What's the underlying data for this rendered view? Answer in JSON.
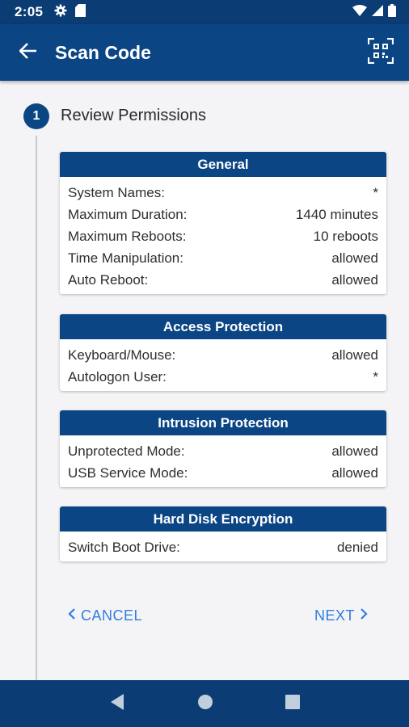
{
  "status_bar": {
    "time": "2:05",
    "icons": [
      "gear-icon",
      "sd-card-icon",
      "wifi-icon",
      "signal-icon",
      "battery-icon"
    ]
  },
  "app_bar": {
    "title": "Scan Code",
    "back_icon": "arrow-left-icon",
    "action_icon": "qr-scan-icon"
  },
  "step": {
    "number": "1",
    "title": "Review Permissions"
  },
  "cards": {
    "general": {
      "header": "General",
      "rows": [
        {
          "label": "System Names:",
          "value": "*"
        },
        {
          "label": "Maximum Duration:",
          "value": "1440 minutes"
        },
        {
          "label": "Maximum Reboots:",
          "value": "10 reboots"
        },
        {
          "label": "Time Manipulation:",
          "value": "allowed"
        },
        {
          "label": "Auto Reboot:",
          "value": "allowed"
        }
      ]
    },
    "access": {
      "header": "Access Protection",
      "rows": [
        {
          "label": "Keyboard/Mouse:",
          "value": "allowed"
        },
        {
          "label": "Autologon User:",
          "value": "*"
        }
      ]
    },
    "intrusion": {
      "header": "Intrusion Protection",
      "rows": [
        {
          "label": "Unprotected Mode:",
          "value": "allowed"
        },
        {
          "label": "USB Service Mode:",
          "value": "allowed"
        }
      ]
    },
    "encryption": {
      "header": "Hard Disk Encryption",
      "rows": [
        {
          "label": "Switch Boot Drive:",
          "value": "denied"
        }
      ]
    }
  },
  "buttons": {
    "cancel": "CANCEL",
    "next": "NEXT"
  },
  "colors": {
    "primary": "#0b4584",
    "status_bar": "#0b3c74",
    "accent": "#2f7de1",
    "background": "#f4f4f6"
  }
}
